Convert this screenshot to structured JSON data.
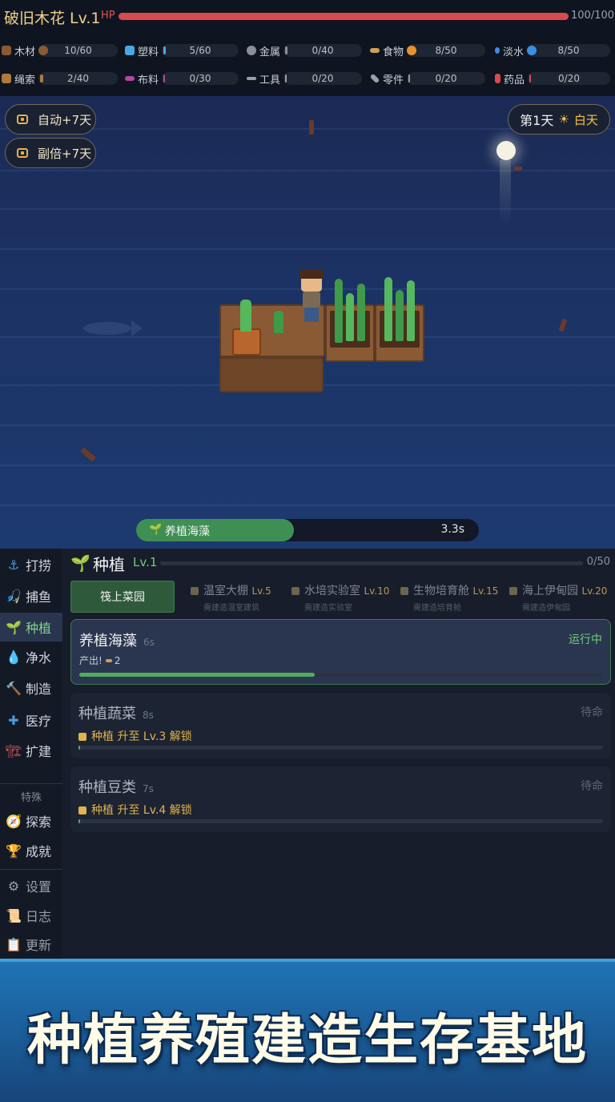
{
  "header": {
    "title": "破旧木花 Lv.1",
    "hp_label": "HP",
    "hp_text": "100/100",
    "hp_fraction": 1.0
  },
  "resources": [
    {
      "name": "木材",
      "value": "10/60",
      "color": "#8a5a34"
    },
    {
      "name": "塑料",
      "value": "5/60",
      "color": "#4aa8e0"
    },
    {
      "name": "金属",
      "value": "0/40",
      "color": "#8a8f98"
    },
    {
      "name": "食物",
      "value": "8/50",
      "color": "#e6922e"
    },
    {
      "name": "淡水",
      "value": "8/50",
      "color": "#3b8fe0"
    },
    {
      "name": "绳索",
      "value": "2/40",
      "color": "#b07a3c"
    },
    {
      "name": "布料",
      "value": "0/30",
      "color": "#b04aa0"
    },
    {
      "name": "工具",
      "value": "0/20",
      "color": "#9aa0a8"
    },
    {
      "name": "零件",
      "value": "0/20",
      "color": "#9aa0a8"
    },
    {
      "name": "药品",
      "value": "0/20",
      "color": "#d84a4e"
    }
  ],
  "sea": {
    "auto_button": "自动+7天",
    "double_button": "副倍+7天",
    "day_label": "第1天",
    "daytime_label": "白天"
  },
  "task": {
    "name": "养植海藻",
    "time": "3.3s",
    "progress": 0.46
  },
  "sidebar": {
    "items": [
      {
        "icon": "anchor-icon",
        "label": "打捞"
      },
      {
        "icon": "fishing-icon",
        "label": "捕鱼"
      },
      {
        "icon": "sprout-icon",
        "label": "种植"
      },
      {
        "icon": "water-drop-icon",
        "label": "净水"
      },
      {
        "icon": "hammer-icon",
        "label": "制造"
      },
      {
        "icon": "medkit-icon",
        "label": "医疗"
      },
      {
        "icon": "crane-icon",
        "label": "扩建"
      }
    ],
    "section_label": "特殊",
    "special": [
      {
        "icon": "compass-icon",
        "label": "探索"
      },
      {
        "icon": "trophy-icon",
        "label": "成就"
      }
    ],
    "bottom": [
      {
        "icon": "gear-icon",
        "label": "设置"
      },
      {
        "icon": "scroll-icon",
        "label": "日志"
      },
      {
        "icon": "clipboard-icon",
        "label": "更新"
      }
    ]
  },
  "panel": {
    "title": "种植",
    "level": "Lv.1",
    "xp_text": "0/50",
    "xp_fraction": 0.0,
    "location_button": "筏上菜园",
    "locked_locations": [
      {
        "name": "温室大棚",
        "level": "Lv.5",
        "sub": "需建造温室建筑"
      },
      {
        "name": "水培实验室",
        "level": "Lv.10",
        "sub": "需建造实验室"
      },
      {
        "name": "生物培育舱",
        "level": "Lv.15",
        "sub": "需建造培育舱"
      },
      {
        "name": "海上伊甸园",
        "level": "Lv.20",
        "sub": "需建造伊甸园"
      }
    ]
  },
  "cards": [
    {
      "name": "养植海藻",
      "time": "6s",
      "status": "运行中",
      "output_label": "产出!",
      "output_value": "2",
      "progress": 0.45
    },
    {
      "name": "种植蔬菜",
      "time": "8s",
      "status": "待命",
      "lock_text": "种植 升至 Lv.3 解锁",
      "progress": 0.0
    },
    {
      "name": "种植豆类",
      "time": "7s",
      "status": "待命",
      "lock_text": "种植 升至 Lv.4 解锁",
      "progress": 0.0
    }
  ],
  "banner": {
    "text": "种植养殖建造生存基地"
  }
}
